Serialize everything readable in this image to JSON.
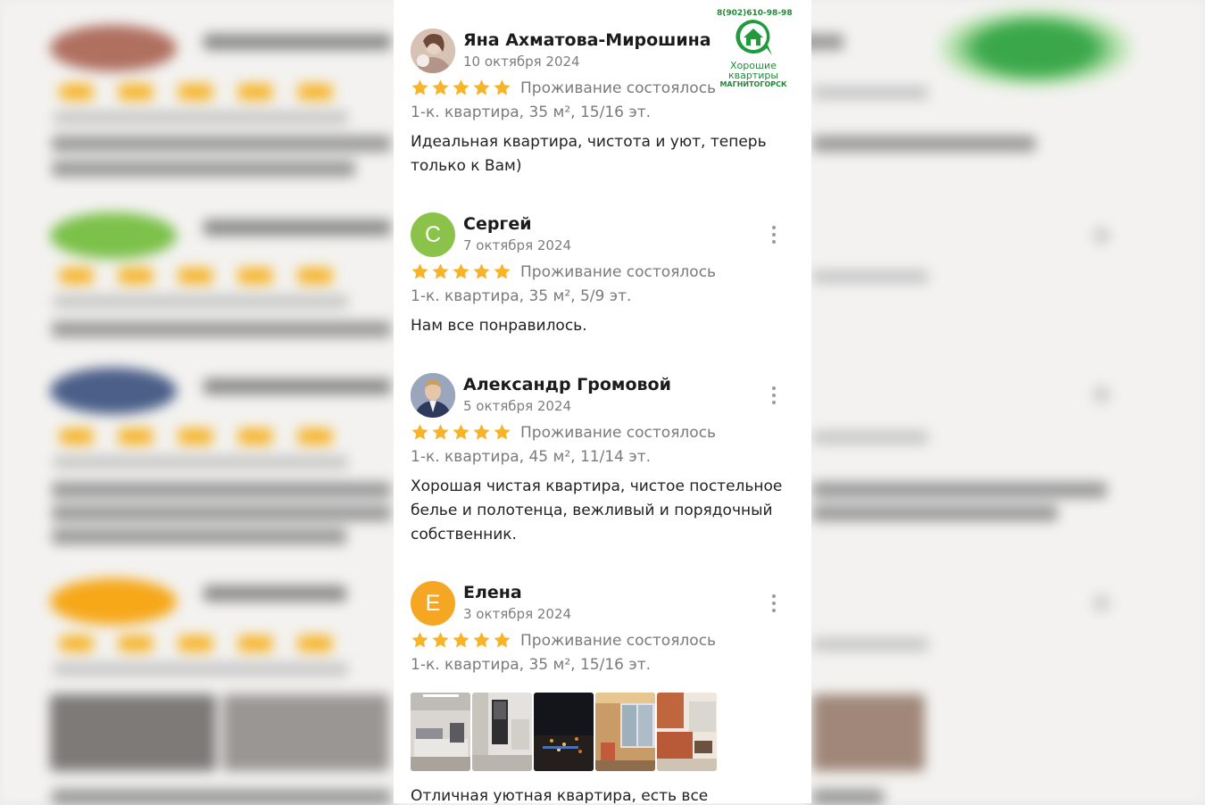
{
  "watermark": {
    "phone": "8(902)610-98-98",
    "line1": "Хорошие",
    "line2": "квартиры",
    "line3": "МАГНИТОГОРСК"
  },
  "reviews": [
    {
      "author": "Яна Ахматова-Мирошина",
      "date": "10 октября 2024",
      "avatar_letter": "",
      "avatar_color": "#b89a8a",
      "rating": 5,
      "status": "Проживание состоялось",
      "apartment": "1-к. квартира, 35 м², 15/16 эт.",
      "text": "Идеальная квартира, чистота и уют, теперь только к Вам)",
      "photos": []
    },
    {
      "author": "Сергей",
      "date": "7 октября 2024",
      "avatar_letter": "С",
      "avatar_color": "#8bc34a",
      "rating": 5,
      "status": "Проживание состоялось",
      "apartment": "1-к. квартира, 35 м², 5/9 эт.",
      "text": "Нам все понравилось.",
      "photos": []
    },
    {
      "author": "Александр Громовой",
      "date": "5 октября 2024",
      "avatar_letter": "",
      "avatar_color": "#5a6b8c",
      "rating": 5,
      "status": "Проживание состоялось",
      "apartment": "1-к. квартира, 45 м², 11/14 эт.",
      "text": "Хорошая чистая квартира, чистое постельное белье и полотенца, вежливый и порядочный собственник.",
      "photos": []
    },
    {
      "author": "Елена",
      "date": "3 октября 2024",
      "avatar_letter": "Е",
      "avatar_color": "#f5a623",
      "rating": 5,
      "status": "Проживание состоялось",
      "apartment": "1-к. квартира, 35 м², 15/16 эт.",
      "text": "Отличная уютная квартира, есть все",
      "photos": [
        "bedroom-photo",
        "hallway-photo",
        "night-view-photo",
        "balcony-photo",
        "kitchen-photo"
      ]
    }
  ],
  "colors": {
    "star": "#f7b429",
    "muted_text": "#7a7a7a",
    "main_text": "#222222"
  },
  "icons": {
    "star": "star-icon",
    "menu": "more-vertical-icon",
    "logo": "house-chat-logo-icon"
  }
}
